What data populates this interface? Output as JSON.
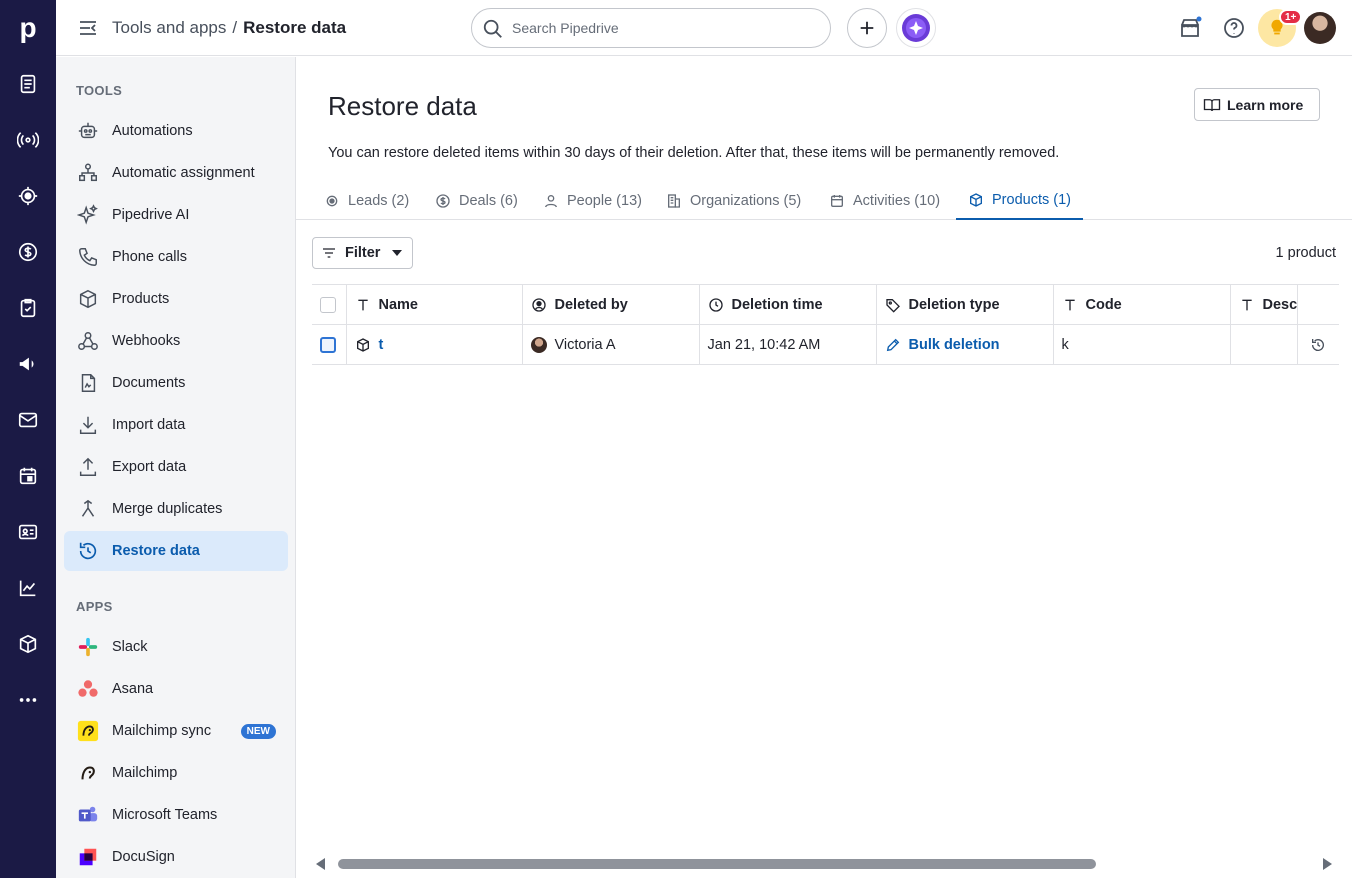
{
  "breadcrumb": {
    "parent": "Tools and apps",
    "separator": "/",
    "current": "Restore data"
  },
  "search": {
    "placeholder": "Search Pipedrive"
  },
  "notifications": {
    "badge": "1+"
  },
  "brand": {
    "logo": "p",
    "rail_color": "#1b1a45",
    "accent": "#0b5cad"
  },
  "rail_icons": [
    "leads-icon",
    "deals-icon",
    "focus-icon",
    "dollar-icon",
    "activities-icon",
    "campaigns-icon",
    "mail-icon",
    "calendar-icon",
    "contacts-icon",
    "insights-icon",
    "products-icon",
    "more-icon"
  ],
  "sidebar": {
    "tools_heading": "TOOLS",
    "tools": [
      {
        "label": "Automations",
        "icon": "robot-icon"
      },
      {
        "label": "Automatic assignment",
        "icon": "assignment-icon"
      },
      {
        "label": "Pipedrive AI",
        "icon": "sparkle-icon"
      },
      {
        "label": "Phone calls",
        "icon": "phone-icon"
      },
      {
        "label": "Products",
        "icon": "box-icon"
      },
      {
        "label": "Webhooks",
        "icon": "webhook-icon"
      },
      {
        "label": "Documents",
        "icon": "document-icon"
      },
      {
        "label": "Import data",
        "icon": "import-icon"
      },
      {
        "label": "Export data",
        "icon": "export-icon"
      },
      {
        "label": "Merge duplicates",
        "icon": "merge-icon"
      },
      {
        "label": "Restore data",
        "icon": "restore-icon"
      }
    ],
    "apps_heading": "APPS",
    "apps": [
      {
        "label": "Slack",
        "icon": "slack-icon"
      },
      {
        "label": "Asana",
        "icon": "asana-icon"
      },
      {
        "label": "Mailchimp sync",
        "icon": "mailchimp-icon",
        "badge": "NEW"
      },
      {
        "label": "Mailchimp",
        "icon": "mailchimp-icon"
      },
      {
        "label": "Microsoft Teams",
        "icon": "teams-icon"
      },
      {
        "label": "DocuSign",
        "icon": "docusign-icon"
      }
    ]
  },
  "main": {
    "title": "Restore data",
    "learn_more": "Learn more",
    "description": "You can restore deleted items within 30 days of their deletion. After that, these items will be permanently removed.",
    "tabs": [
      {
        "label": "Leads (2)",
        "icon": "leads-icon"
      },
      {
        "label": "Deals (6)",
        "icon": "dollar-icon"
      },
      {
        "label": "People (13)",
        "icon": "person-icon"
      },
      {
        "label": "Organizations (5)",
        "icon": "building-icon"
      },
      {
        "label": "Activities (10)",
        "icon": "calendar-icon"
      },
      {
        "label": "Products (1)",
        "icon": "box-icon"
      }
    ],
    "filter_label": "Filter",
    "result_count": "1 product",
    "columns": [
      "Name",
      "Deleted by",
      "Deletion time",
      "Deletion type",
      "Code",
      "Desc"
    ],
    "rows": [
      {
        "name": "t",
        "deleted_by": "Victoria A",
        "deletion_time": "Jan 21, 10:42 AM",
        "deletion_type": "Bulk deletion",
        "code": "k",
        "description": ""
      }
    ]
  }
}
